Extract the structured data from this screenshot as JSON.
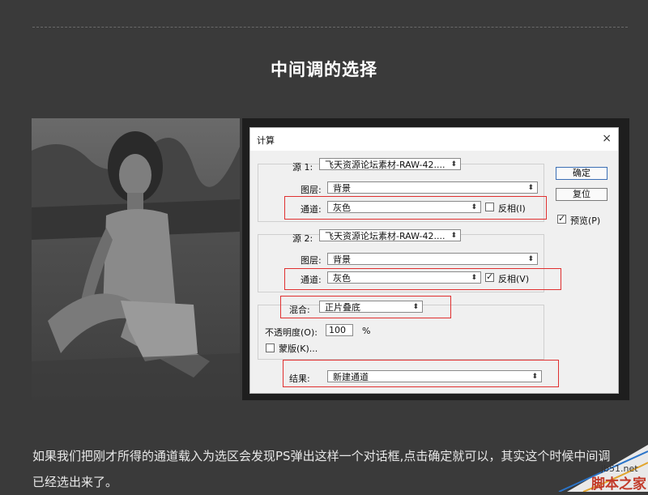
{
  "heading": "中间调的选择",
  "dialog": {
    "title": "计算",
    "close": "×",
    "source1": {
      "label": "源 1:",
      "file": "飞天资源论坛素材-RAW-42....",
      "layer_label": "图层:",
      "layer": "背景",
      "channel_label": "通道:",
      "channel": "灰色",
      "invert_label": "反相(I)",
      "invert_checked": false
    },
    "source2": {
      "label": "源 2:",
      "file": "飞天资源论坛素材-RAW-42....",
      "layer_label": "图层:",
      "layer": "背景",
      "channel_label": "通道:",
      "channel": "灰色",
      "invert_label": "反相(V)",
      "invert_checked": true
    },
    "blend_label": "混合:",
    "blend": "正片叠底",
    "opacity_label": "不透明度(O):",
    "opacity": "100",
    "opacity_unit": "%",
    "mask_label": "蒙版(K)...",
    "result_label": "结果:",
    "result": "新建通道",
    "ok": "确定",
    "reset": "复位",
    "preview_label": "预览(P)",
    "preview_checked": true
  },
  "paragraph": "如果我们把刚才所得的通道载入为选区会发现PS弹出这样一个对话框,点击确定就可以，其实这个时候中间调已经选出来了。",
  "watermark": {
    "site": "jb51.net",
    "name": "脚本之家"
  },
  "colors": {
    "background": "#3a3a3a",
    "highlight": "#e03030",
    "primary_border": "#3b6fb5"
  }
}
